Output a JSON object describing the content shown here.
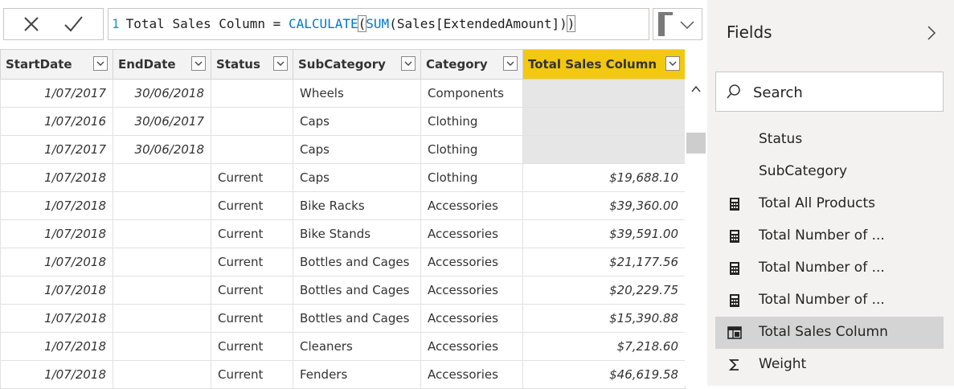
{
  "formula_bar": {
    "line_number": "1",
    "prefix": "Total Sales Column = ",
    "fn_calculate": "CALCULATE",
    "paren_open": "(",
    "fn_sum": "SUM",
    "args": "(Sales[ExtendedAmount])",
    "paren_close": ")"
  },
  "table": {
    "columns": [
      {
        "label": "StartDate"
      },
      {
        "label": "EndDate"
      },
      {
        "label": "Status"
      },
      {
        "label": "SubCategory"
      },
      {
        "label": "Category"
      },
      {
        "label": "Total Sales Column",
        "selected": true
      }
    ],
    "rows": [
      [
        "1/07/2017",
        "30/06/2018",
        "",
        "Wheels",
        "Components",
        ""
      ],
      [
        "1/07/2016",
        "30/06/2017",
        "",
        "Caps",
        "Clothing",
        ""
      ],
      [
        "1/07/2017",
        "30/06/2018",
        "",
        "Caps",
        "Clothing",
        ""
      ],
      [
        "1/07/2018",
        "",
        "Current",
        "Caps",
        "Clothing",
        "$19,688.10"
      ],
      [
        "1/07/2018",
        "",
        "Current",
        "Bike Racks",
        "Accessories",
        "$39,360.00"
      ],
      [
        "1/07/2018",
        "",
        "Current",
        "Bike Stands",
        "Accessories",
        "$39,591.00"
      ],
      [
        "1/07/2018",
        "",
        "Current",
        "Bottles and Cages",
        "Accessories",
        "$21,177.56"
      ],
      [
        "1/07/2018",
        "",
        "Current",
        "Bottles and Cages",
        "Accessories",
        "$20,229.75"
      ],
      [
        "1/07/2018",
        "",
        "Current",
        "Bottles and Cages",
        "Accessories",
        "$15,390.88"
      ],
      [
        "1/07/2018",
        "",
        "Current",
        "Cleaners",
        "Accessories",
        "$7,218.60"
      ],
      [
        "1/07/2018",
        "",
        "Current",
        "Fenders",
        "Accessories",
        "$46,619.58"
      ]
    ]
  },
  "fields_pane": {
    "title": "Fields",
    "search_placeholder": "Search",
    "items": [
      {
        "label": "Status",
        "icon": "none"
      },
      {
        "label": "SubCategory",
        "icon": "none"
      },
      {
        "label": "Total All Products",
        "icon": "calculator-icon"
      },
      {
        "label": "Total Number of ...",
        "icon": "calculator-icon"
      },
      {
        "label": "Total Number of ...",
        "icon": "calculator-icon"
      },
      {
        "label": "Total Number of ...",
        "icon": "calculator-icon"
      },
      {
        "label": "Total Sales Column",
        "icon": "calculated-column-icon",
        "active": true
      },
      {
        "label": "Weight",
        "icon": "sigma-icon"
      }
    ]
  },
  "colors": {
    "selected_header": "#f2c811",
    "pane_background": "#f3f2f1",
    "formula_function": "#0078d4"
  }
}
